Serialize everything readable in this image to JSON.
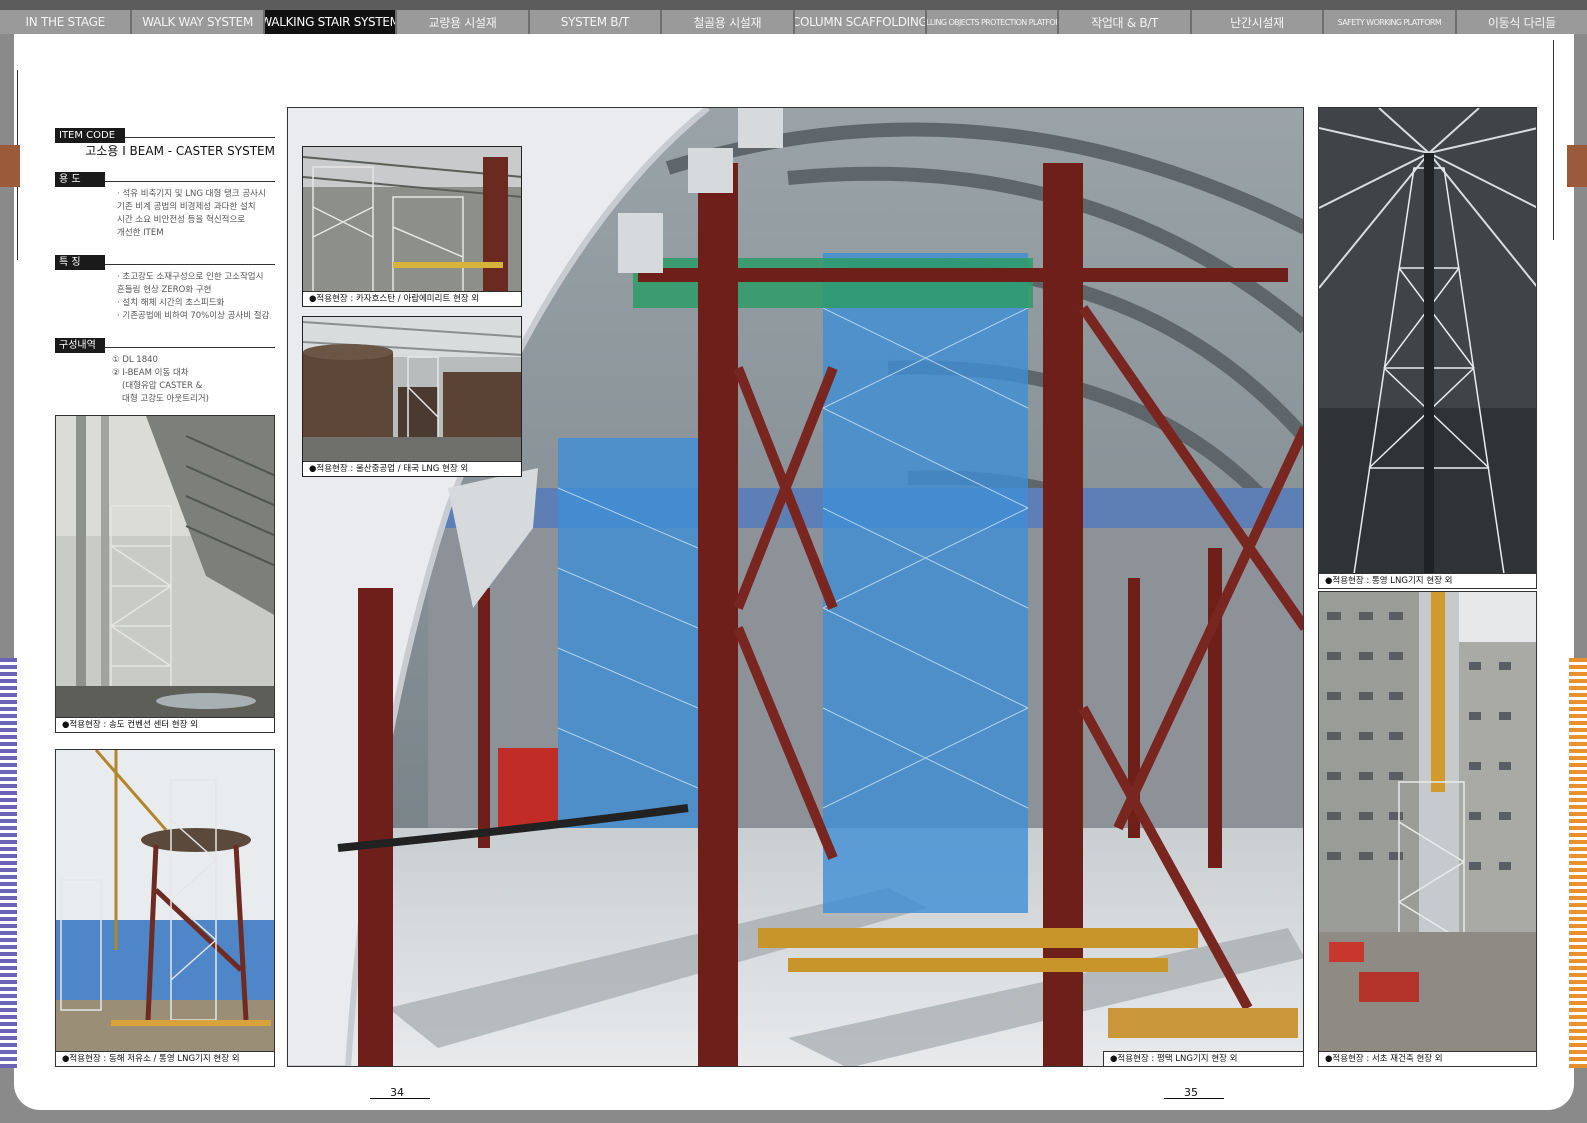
{
  "nav": {
    "tabs": [
      {
        "label": "IN THE STAGE",
        "active": false,
        "small": false
      },
      {
        "label": "WALK WAY SYSTEM",
        "active": false,
        "small": false
      },
      {
        "label": "WALKING STAIR SYSTEM",
        "active": true,
        "small": false
      },
      {
        "label": "교량용 시설재",
        "active": false,
        "small": false
      },
      {
        "label": "SYSTEM B/T",
        "active": false,
        "small": false
      },
      {
        "label": "철골용 시설재",
        "active": false,
        "small": false
      },
      {
        "label": "COLUMN SCAFFOLDING",
        "active": false,
        "small": false
      },
      {
        "label": "FALLING OBJECTS PROTECTION PLATFORM",
        "active": false,
        "small": true
      },
      {
        "label": "작업대 & B/T",
        "active": false,
        "small": false
      },
      {
        "label": "난간시설재",
        "active": false,
        "small": false
      },
      {
        "label": "SAFETY WORKING PLATFORM",
        "active": false,
        "small": true
      },
      {
        "label": "이동식 다리들",
        "active": false,
        "small": false
      }
    ]
  },
  "info": {
    "item_code_label": "ITEM CODE",
    "item_name": "고소용 I BEAM - CASTER SYSTEM",
    "usage_label": "용  도",
    "usage_lines": [
      "· 석유 비축기지 및 LNG 대형 탱크 공사시",
      "기존 비계 공법의 비경제성 과다한 설치",
      "시간 소요 비안전성 등을 혁신적으로",
      "개선한 ITEM"
    ],
    "feature_label": "특  징",
    "feature_lines": [
      "· 초고강도 소재구성으로 인한 고소작업시",
      "흔들림 현상 ZERO화 구현",
      "· 설치 해체 시간의 초스피드화",
      "· 기존공법에 비하여 70%이상 공사비 절감"
    ],
    "composition_label": "구성내역",
    "composition_lines": [
      "① DL 1840",
      "② I-BEAM 이동 대차",
      "(대형유압 CASTER &",
      "대형 고강도 아웃트리거)"
    ]
  },
  "captions": {
    "left_top": "●적용현장 : 송도 컨벤션 센터 현장 외",
    "left_bottom": "●적용현장 : 동해 저유소 / 통영 LNG기지 현장 외",
    "inset_top": "●적용현장 : 카자흐스탄 / 아랍에미리트 현장 외",
    "inset_bottom": "●적용현장 : 울산중공업 / 태국 LNG 현장 외",
    "main": "●적용현장 : 평택 LNG기지 현장 외",
    "right_top": "●적용현장 : 통영 LNG기지 현장 외",
    "right_bottom": "●적용현장 : 서초 재건축 현장 외"
  },
  "page_numbers": {
    "left": "34",
    "right": "35"
  },
  "colors": {
    "active_tab": "#111111",
    "tab": "#9a9a9a",
    "left_stripes": "#6a63b8",
    "right_stripes": "#e8902e",
    "steel_red": "#6e1f1a",
    "mesh_blue": "#3f8fd6"
  }
}
